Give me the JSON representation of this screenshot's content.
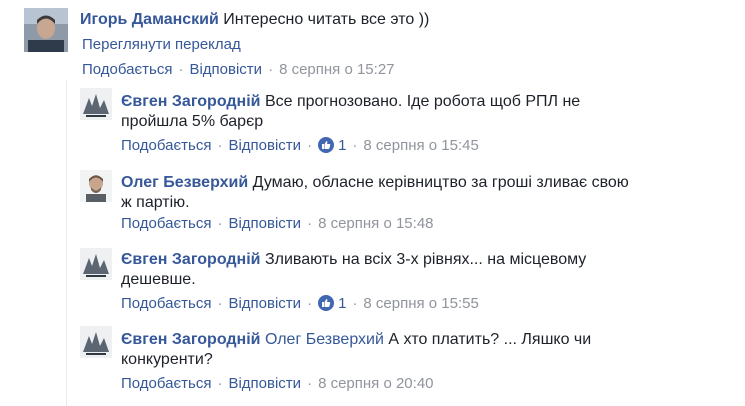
{
  "top_comment": {
    "author": "Игорь Даманский",
    "text": "Интересно читать все это ))",
    "translate_link": "Переглянути переклад",
    "like_label": "Подобається",
    "reply_label": "Відповісти",
    "time": "8 серпня о 15:27"
  },
  "replies": [
    {
      "author": "Євген Загородній",
      "text_line1": "Все прогнозовано. Іде робота щоб РПЛ не",
      "text_line2": "пройшла 5% барєр",
      "like_label": "Подобається",
      "reply_label": "Відповісти",
      "likes": "1",
      "time": "8 серпня о 15:45"
    },
    {
      "author": "Олег Безверхий",
      "text_line1": "Думаю, обласне керівництво за гроші зливає свою",
      "text_line2": "ж партію.",
      "like_label": "Подобається",
      "reply_label": "Відповісти",
      "time": "8 серпня о 15:48"
    },
    {
      "author": "Євген Загородній",
      "text_line1": "Зливають на всіх 3-х рівнях... на місцевому",
      "text_line2": "дешевше.",
      "like_label": "Подобається",
      "reply_label": "Відповісти",
      "likes": "1",
      "time": "8 серпня о 15:55"
    },
    {
      "author": "Євген Загородній",
      "mention": "Олег Безверхий",
      "text_line1": "А хто платить? ... Ляшко чи",
      "text_line2": "конкуренти?",
      "like_label": "Подобається",
      "reply_label": "Відповісти",
      "time": "8 серпня о 20:40"
    }
  ],
  "colors": {
    "link": "#365899",
    "text": "#1d2129",
    "meta": "#90949c",
    "like_badge": "#4267b2"
  },
  "icons": {
    "like_badge": "thumbs-up-icon"
  }
}
